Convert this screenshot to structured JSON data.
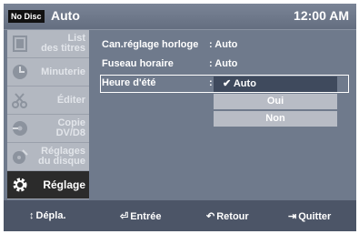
{
  "header": {
    "badge": "No Disc",
    "mode": "Auto",
    "time": "12:00 AM"
  },
  "sidebar": {
    "items": [
      {
        "label": "List\ndes titres",
        "icon": "film-icon",
        "active": false
      },
      {
        "label": "Minuterie",
        "icon": "timer-icon",
        "active": false
      },
      {
        "label": "Éditer",
        "icon": "scissors-icon",
        "active": false
      },
      {
        "label": "Copie\nDV/D8",
        "icon": "copy-disc-icon",
        "active": false
      },
      {
        "label": "Réglages\ndu disque",
        "icon": "disc-settings-icon",
        "active": false
      },
      {
        "label": "Réglage",
        "icon": "gear-icon",
        "active": true
      }
    ]
  },
  "settings": {
    "rows": [
      {
        "label": "Can.réglage horloge",
        "value": ": Auto"
      },
      {
        "label": "Fuseau horaire",
        "value": ": Auto"
      },
      {
        "label": "Heure d'été",
        "value": ":"
      }
    ]
  },
  "dropdown": {
    "options": [
      {
        "label": "✔ Auto",
        "selected": true
      },
      {
        "label": "Oui",
        "selected": false
      },
      {
        "label": "Non",
        "selected": false
      }
    ]
  },
  "footer": {
    "move": {
      "icon": "↕",
      "label": "Dépla."
    },
    "enter": {
      "icon": "⏎",
      "label": "Entrée"
    },
    "back": {
      "icon": "↶",
      "label": "Retour"
    },
    "quit": {
      "icon": "⇥",
      "label": "Quitter"
    }
  },
  "colors": {
    "screen_bg": "#6f7a8c",
    "footer_bg": "#4c5567",
    "sidebar_bg": "#b3b8c1",
    "active_item": "#2b2b2b"
  }
}
